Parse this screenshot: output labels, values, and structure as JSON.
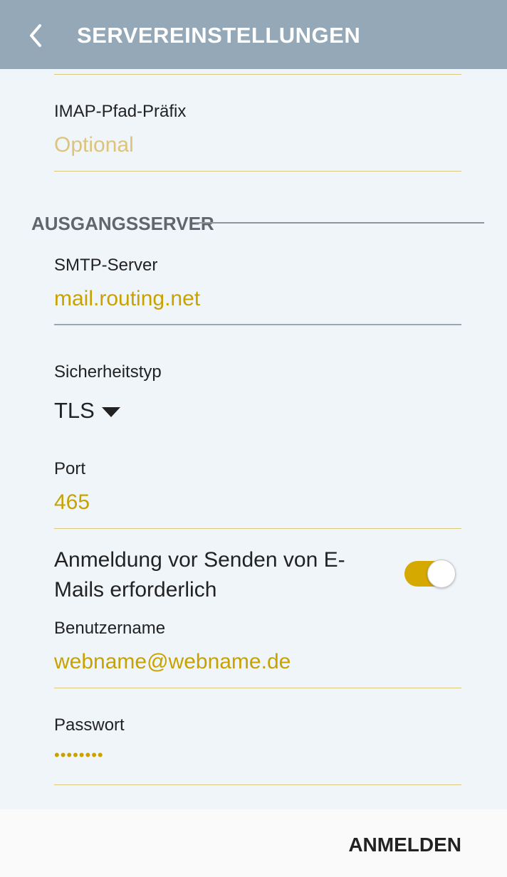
{
  "header": {
    "title": "SERVEREINSTELLUNGEN"
  },
  "imap_path_prefix": {
    "label": "IMAP-Pfad-Präfix",
    "placeholder": "Optional"
  },
  "outgoing_section": {
    "title": "AUSGANGSSERVER"
  },
  "smtp_server": {
    "label": "SMTP-Server",
    "value": "mail.routing.net"
  },
  "security_type": {
    "label": "Sicherheitstyp",
    "value": "TLS"
  },
  "port": {
    "label": "Port",
    "value": "465"
  },
  "auth_required": {
    "text": "Anmeldung vor Senden von E-Mails erforderlich",
    "enabled": true
  },
  "username": {
    "label": "Benutzername",
    "value": "webname@webname.de"
  },
  "password": {
    "label": "Passwort",
    "masked_value": "••••••••"
  },
  "footer": {
    "signin_label": "ANMELDEN"
  },
  "colors": {
    "header_bg": "#94a8b8",
    "accent": "#c7a200",
    "toggle_on": "#d6a900"
  },
  "icons": {
    "back": "back-icon",
    "dropdown": "dropdown-arrow-icon"
  }
}
